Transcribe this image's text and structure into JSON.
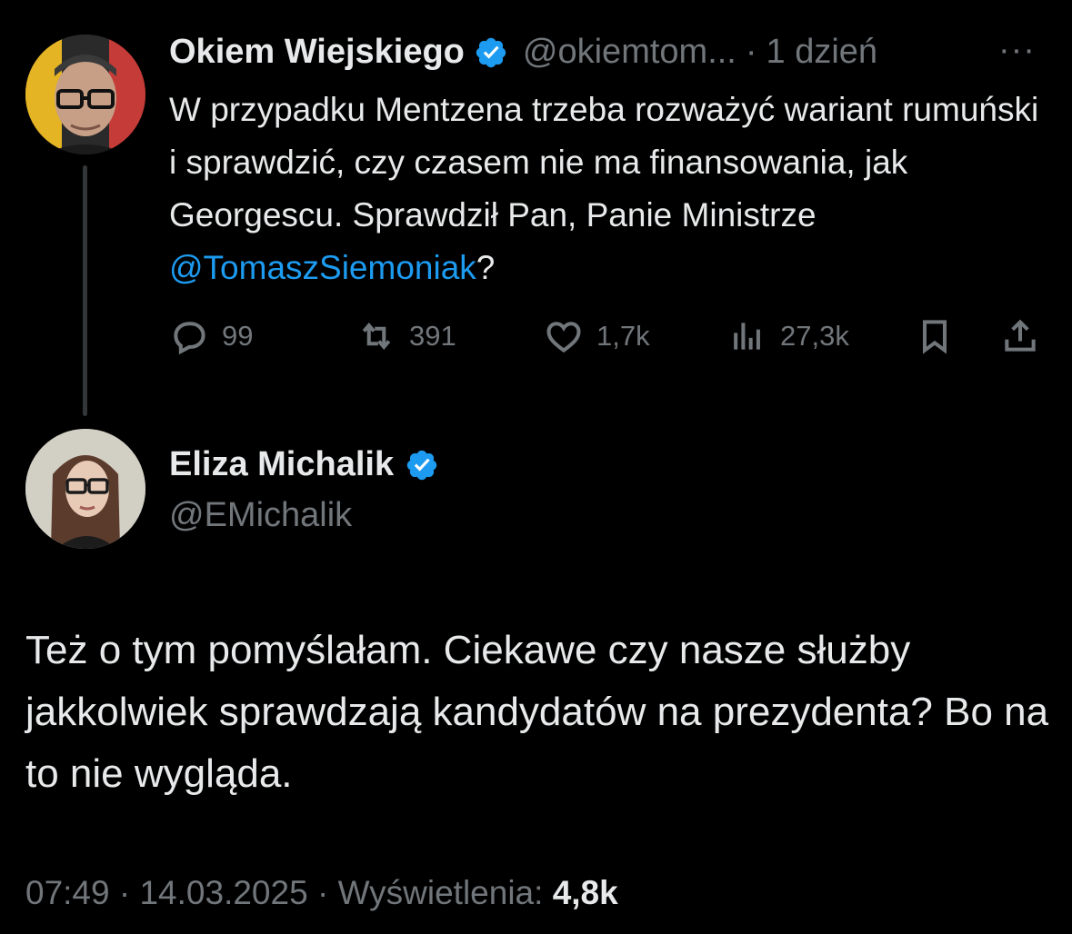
{
  "original_tweet": {
    "author_name": "Okiem Wiejskiego",
    "handle": "@okiemtom...",
    "separator": "·",
    "time": "1 dzień",
    "more_label": "···",
    "text_before_mention": "W przypadku Mentzena trzeba rozważyć wariant rumuński i sprawdzić, czy czasem nie ma finansowania, jak Georgescu. Sprawdził Pan, Panie Ministrze ",
    "mention": "@TomaszSiemoniak",
    "text_after_mention": "?",
    "stats": {
      "replies": "99",
      "reposts": "391",
      "likes": "1,7k",
      "views": "27,3k"
    }
  },
  "reply_tweet": {
    "author_name": "Eliza Michalik",
    "handle": "@EMichalik",
    "text": "Też o tym pomyślałam. Ciekawe czy nasze służby jakkolwiek sprawdzają kandydatów na prezydenta? Bo na to nie wygląda.",
    "time": "07:49",
    "date": "14.03.2025",
    "views_label": "Wyświetlenia:",
    "views_value": "4,8k",
    "separator": "·"
  },
  "colors": {
    "background": "#000000",
    "text": "#e7e9ea",
    "muted": "#71767b",
    "accent": "#1d9bf0"
  },
  "icons": {
    "verified": "verified-badge-icon",
    "reply": "speech-bubble-icon",
    "repost": "repost-arrows-icon",
    "like": "heart-icon",
    "views": "bar-chart-icon",
    "bookmark": "bookmark-icon",
    "share": "share-upload-icon"
  }
}
